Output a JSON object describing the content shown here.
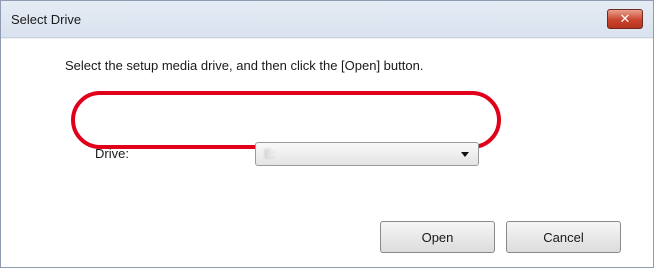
{
  "window": {
    "title": "Select Drive",
    "close_icon": "close-icon",
    "close_glyph": "✕"
  },
  "instruction": "Select the setup media drive, and then click the [Open] button.",
  "drive": {
    "label": "Drive:",
    "selected_value": "E:",
    "dropdown_icon": "chevron-down-icon"
  },
  "highlight_color": "#e0001b",
  "buttons": {
    "open_label": "Open",
    "cancel_label": "Cancel"
  }
}
